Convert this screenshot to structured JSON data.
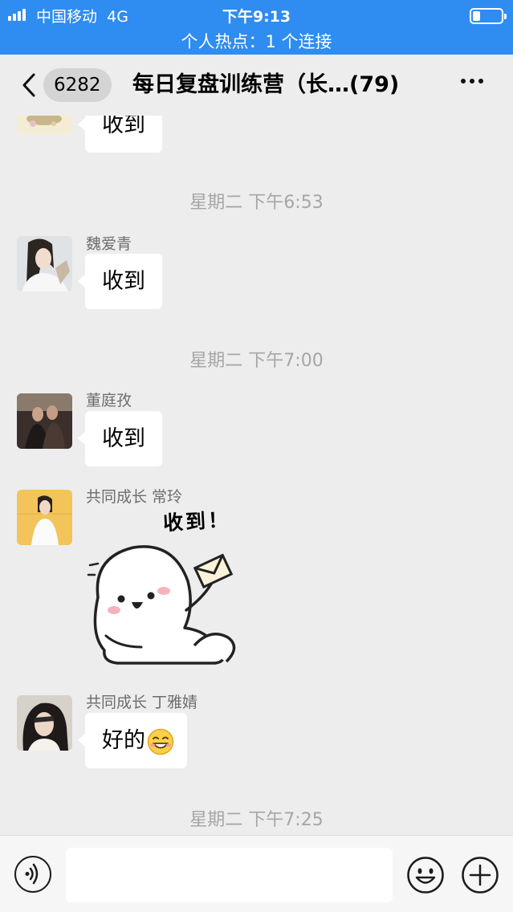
{
  "status_bar": {
    "carrier": "中国移动",
    "network": "4G",
    "time": "下午9:13",
    "hotspot": "个人热点：1 个连接",
    "battery_level": 0.25
  },
  "nav": {
    "back_icon": "chevron-left-icon",
    "unread_count": "6282",
    "title": "每日复盘训练营（长…(79)",
    "more_icon": "more-dots-icon"
  },
  "messages": [
    {
      "type": "text",
      "text": "收到"
    },
    {
      "type": "time",
      "text": "星期二 下午6:53"
    },
    {
      "type": "text",
      "sender": "魏爱青",
      "text": "收到"
    },
    {
      "type": "time",
      "text": "星期二 下午7:00"
    },
    {
      "type": "text",
      "sender": "董庭孜",
      "text": "收到"
    },
    {
      "type": "sticker",
      "sender": "共同成长 常玲",
      "sticker_text": "收到！"
    },
    {
      "type": "text",
      "sender": "共同成长 丁雅婧",
      "text": "好的",
      "emoji": "grinning-emoji-icon"
    },
    {
      "type": "time",
      "text": "星期二 下午7:25"
    }
  ],
  "input_bar": {
    "voice_icon": "voice-icon",
    "emoji_icon": "emoji-icon",
    "plus_icon": "plus-icon",
    "placeholder": ""
  },
  "colors": {
    "status_bar_bg": "#2f8cf0",
    "chat_bg": "#ededed",
    "bubble_bg": "#ffffff"
  }
}
